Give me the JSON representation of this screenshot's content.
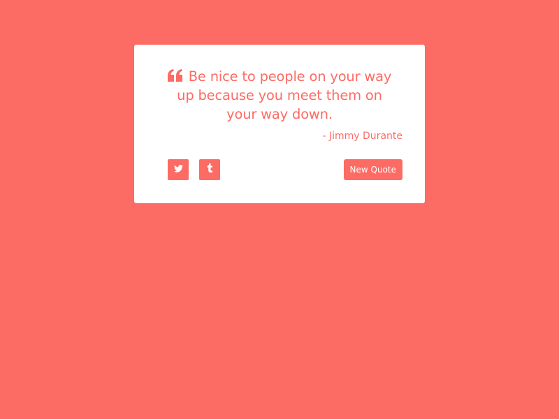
{
  "quote": {
    "text": "Be nice to people on your way up because you meet them on your way down.",
    "author": "- Jimmy Durante",
    "icon": "quote-left-icon"
  },
  "actions": {
    "twitter_icon": "twitter-icon",
    "tumblr_icon": "tumblr-icon",
    "new_quote_label": "New Quote"
  },
  "colors": {
    "background": "#fc6b64",
    "card": "#ffffff",
    "accent": "#fc6b64"
  }
}
